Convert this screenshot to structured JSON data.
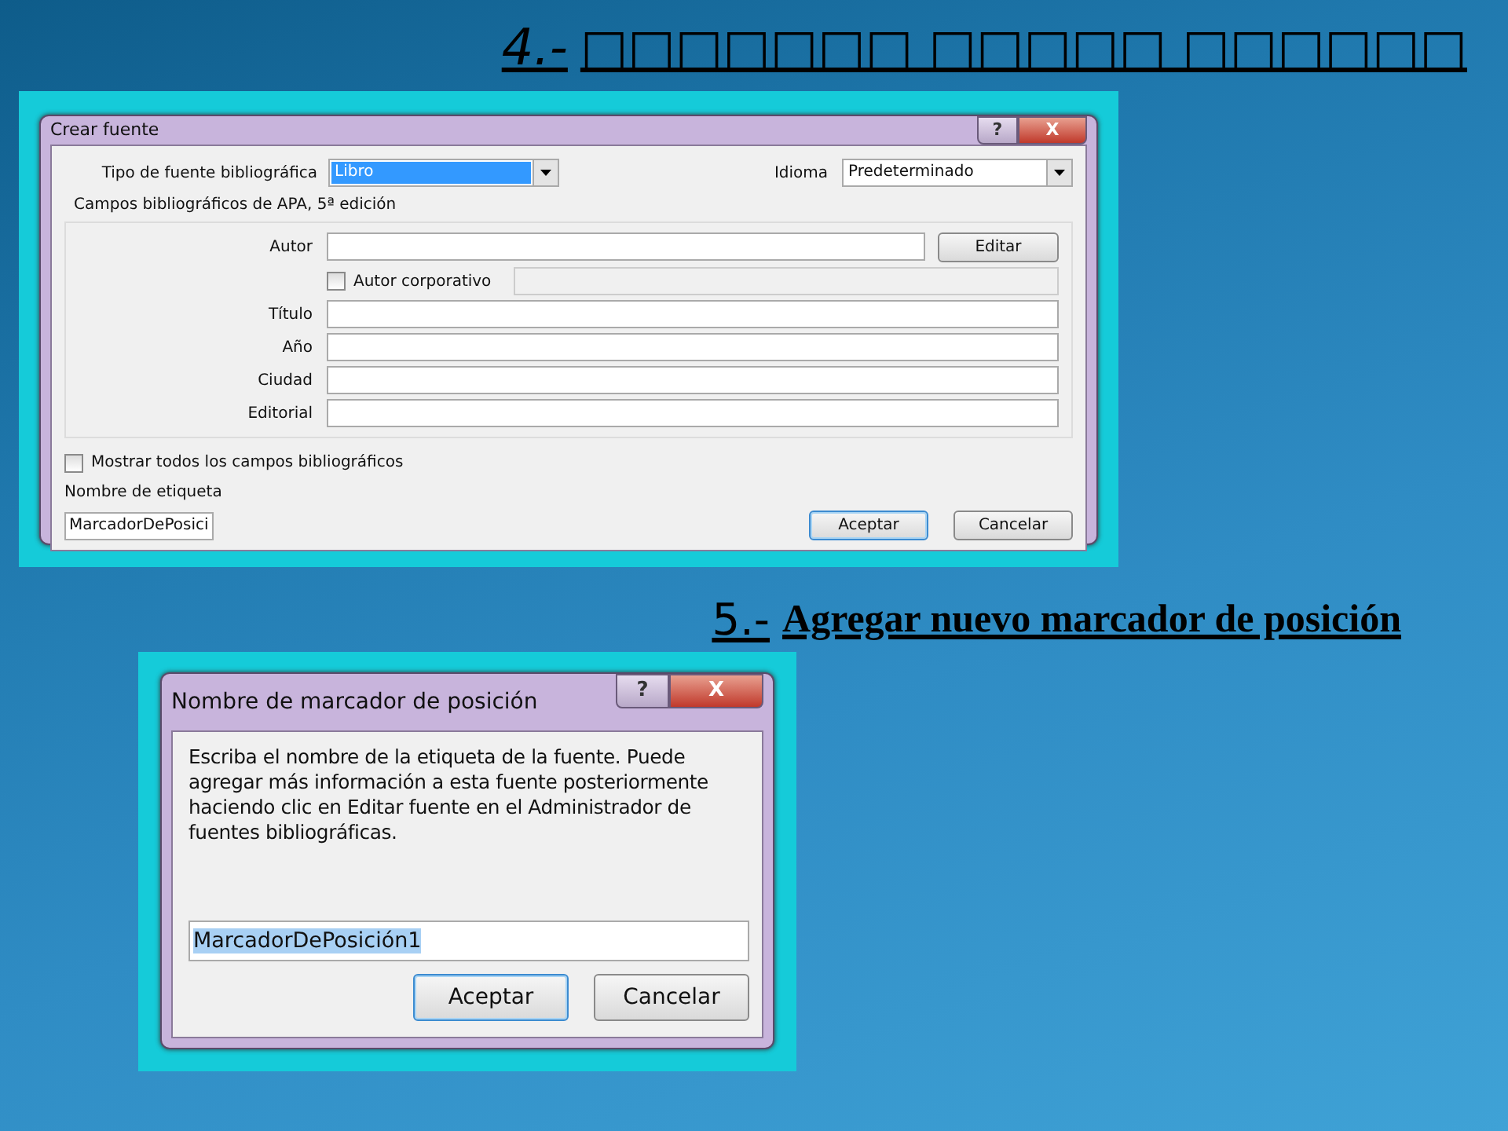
{
  "heading_1": {
    "number": "4.-",
    "text": "□□□□□□□ □□□□□ □□□□□□"
  },
  "dialog_1": {
    "title": "Crear fuente",
    "title_buttons": [
      "?",
      "X"
    ],
    "source_type": {
      "label": "Tipo de fuente bibliográfica",
      "value": "Libro",
      "selected": true
    },
    "language": {
      "label": "Idioma",
      "value": "Predeterminado"
    },
    "group_title": "Campos bibliográficos de APA, 5ª edición",
    "author": {
      "label": "Autor",
      "button": "Editar"
    },
    "corporate_author": {
      "label": "Autor corporativo",
      "checked": false
    },
    "fields": [
      {
        "label": "Título"
      },
      {
        "label": "Año"
      },
      {
        "label": "Ciudad"
      },
      {
        "label": "Editorial"
      }
    ],
    "show_all": {
      "label": "Mostrar todos los campos bibliográficos",
      "checked": false
    },
    "tag_name": {
      "label": "Nombre de etiqueta",
      "value": "MarcadorDePosici"
    },
    "buttons": [
      {
        "label": "Aceptar",
        "default": true
      },
      {
        "label": "Cancelar",
        "default": false
      }
    ]
  },
  "heading_2": {
    "number": "5.-",
    "text": "Agregar nuevo marcador de posición"
  },
  "dialog_2": {
    "title": "Nombre de marcador de posición",
    "title_buttons": [
      "?",
      "X"
    ],
    "message": "Escriba el nombre de la etiqueta de la fuente. Puede agregar más información a esta fuente posteriormente haciendo clic en Editar fuente en el Administrador de fuentes bibliográficas.",
    "input": {
      "value": "MarcadorDePosición1",
      "selected": true
    },
    "buttons": [
      {
        "label": "Aceptar",
        "default": true
      },
      {
        "label": "Cancelar",
        "default": false
      }
    ]
  }
}
